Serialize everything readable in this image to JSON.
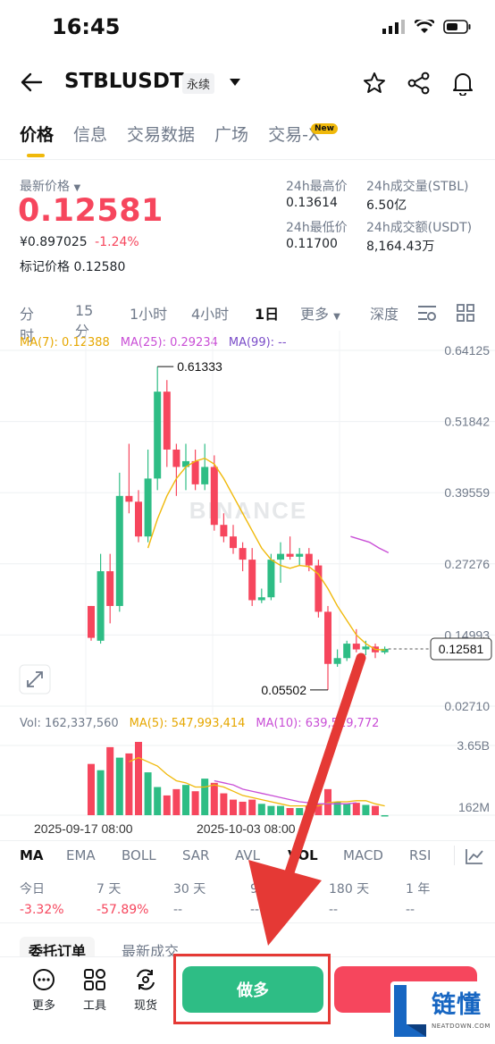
{
  "status": {
    "time": "16:45"
  },
  "header": {
    "pair": "STBLUSDT",
    "contract_type": "永续"
  },
  "tabs": [
    {
      "label": "价格"
    },
    {
      "label": "信息"
    },
    {
      "label": "交易数据"
    },
    {
      "label": "广场"
    },
    {
      "label": "交易-X"
    }
  ],
  "new_badge": "New",
  "price_panel": {
    "last_price_label": "最新价格",
    "last_price": "0.12581",
    "cny_price": "¥0.897025",
    "change_pct": "-1.24%",
    "mark_price_label": "标记价格",
    "mark_price": "0.12580",
    "high_label": "24h最高价",
    "high": "0.13614",
    "vol_label": "24h成交量(STBL)",
    "vol": "6.50亿",
    "low_label": "24h最低价",
    "low": "0.11700",
    "amount_label": "24h成交额(USDT)",
    "amount": "8,164.43万"
  },
  "intervals": [
    "分时",
    "15分",
    "1小时",
    "4小时",
    "1日",
    "更多",
    "深度"
  ],
  "active_interval": "1日",
  "ma_legend": {
    "ma7": "MA(7): 0.12388",
    "ma25": "MA(25): 0.29234",
    "ma99": "MA(99): --"
  },
  "price_axis": [
    "0.64125",
    "0.51842",
    "0.39559",
    "0.27276",
    "0.14993",
    "0.02710"
  ],
  "current_price_tag": "0.12581",
  "high_marker": "0.61333",
  "low_marker": "0.05502",
  "watermark": "BINANCE",
  "vol_legend": {
    "vol": "Vol: 162,337,560",
    "ma5": "MA(5): 547,993,414",
    "ma10": "MA(10): 639,519,772"
  },
  "vol_axis": [
    "3.65B",
    "162M"
  ],
  "date_labels": [
    "2025-09-17 08:00",
    "2025-10-03 08:00"
  ],
  "indicators": [
    "MA",
    "EMA",
    "BOLL",
    "SAR",
    "AVL",
    "VOL",
    "MACD",
    "RSI"
  ],
  "performance": [
    {
      "label": "今日",
      "value": "-3.32%"
    },
    {
      "label": "7 天",
      "value": "-57.89%"
    },
    {
      "label": "30 天",
      "value": "--"
    },
    {
      "label": "90 天",
      "value": "--"
    },
    {
      "label": "180 天",
      "value": "--"
    },
    {
      "label": "1 年",
      "value": "--"
    }
  ],
  "order_tabs": [
    "委托订单",
    "最新成交"
  ],
  "bottom_tools": [
    {
      "label": "更多"
    },
    {
      "label": "工具"
    },
    {
      "label": "现货"
    }
  ],
  "long_button": "做多",
  "logo_text": "链懂",
  "logo_sub": "NEATDOWN.COM",
  "colors": {
    "up": "#2ebd85",
    "down": "#f6465d",
    "accent": "#f0b90b",
    "ma7": "#f0b90b",
    "ma25": "#c94fd6",
    "annotation": "#e53935"
  },
  "chart_data": {
    "type": "candlestick",
    "ylim": [
      0.0271,
      0.64125
    ],
    "candles": [
      {
        "o": 0.2,
        "h": 0.2,
        "l": 0.14,
        "c": 0.145
      },
      {
        "o": 0.14,
        "h": 0.29,
        "l": 0.135,
        "c": 0.26
      },
      {
        "o": 0.26,
        "h": 0.29,
        "l": 0.17,
        "c": 0.2
      },
      {
        "o": 0.2,
        "h": 0.43,
        "l": 0.19,
        "c": 0.39
      },
      {
        "o": 0.39,
        "h": 0.48,
        "l": 0.36,
        "c": 0.38
      },
      {
        "o": 0.38,
        "h": 0.4,
        "l": 0.31,
        "c": 0.32
      },
      {
        "o": 0.32,
        "h": 0.47,
        "l": 0.31,
        "c": 0.42
      },
      {
        "o": 0.42,
        "h": 0.613,
        "l": 0.4,
        "c": 0.57
      },
      {
        "o": 0.57,
        "h": 0.59,
        "l": 0.44,
        "c": 0.47
      },
      {
        "o": 0.47,
        "h": 0.48,
        "l": 0.39,
        "c": 0.44
      },
      {
        "o": 0.44,
        "h": 0.48,
        "l": 0.4,
        "c": 0.45
      },
      {
        "o": 0.45,
        "h": 0.47,
        "l": 0.4,
        "c": 0.41
      },
      {
        "o": 0.41,
        "h": 0.48,
        "l": 0.4,
        "c": 0.44
      },
      {
        "o": 0.44,
        "h": 0.46,
        "l": 0.33,
        "c": 0.34
      },
      {
        "o": 0.34,
        "h": 0.36,
        "l": 0.31,
        "c": 0.32
      },
      {
        "o": 0.32,
        "h": 0.34,
        "l": 0.29,
        "c": 0.3
      },
      {
        "o": 0.3,
        "h": 0.31,
        "l": 0.26,
        "c": 0.28
      },
      {
        "o": 0.28,
        "h": 0.3,
        "l": 0.2,
        "c": 0.21
      },
      {
        "o": 0.21,
        "h": 0.23,
        "l": 0.205,
        "c": 0.215
      },
      {
        "o": 0.215,
        "h": 0.29,
        "l": 0.21,
        "c": 0.28
      },
      {
        "o": 0.28,
        "h": 0.31,
        "l": 0.24,
        "c": 0.29
      },
      {
        "o": 0.29,
        "h": 0.32,
        "l": 0.28,
        "c": 0.285
      },
      {
        "o": 0.285,
        "h": 0.3,
        "l": 0.27,
        "c": 0.29
      },
      {
        "o": 0.29,
        "h": 0.3,
        "l": 0.26,
        "c": 0.27
      },
      {
        "o": 0.27,
        "h": 0.28,
        "l": 0.18,
        "c": 0.19
      },
      {
        "o": 0.19,
        "h": 0.2,
        "l": 0.055,
        "c": 0.1
      },
      {
        "o": 0.1,
        "h": 0.125,
        "l": 0.095,
        "c": 0.11
      },
      {
        "o": 0.11,
        "h": 0.14,
        "l": 0.105,
        "c": 0.135
      },
      {
        "o": 0.135,
        "h": 0.16,
        "l": 0.12,
        "c": 0.125
      },
      {
        "o": 0.125,
        "h": 0.14,
        "l": 0.115,
        "c": 0.13
      },
      {
        "o": 0.13,
        "h": 0.135,
        "l": 0.11,
        "c": 0.12
      },
      {
        "o": 0.12,
        "h": 0.13,
        "l": 0.117,
        "c": 0.126
      }
    ],
    "ma7": [
      null,
      null,
      null,
      null,
      null,
      null,
      0.3,
      0.35,
      0.39,
      0.42,
      0.44,
      0.45,
      0.455,
      0.445,
      0.42,
      0.39,
      0.36,
      0.33,
      0.3,
      0.28,
      0.27,
      0.265,
      0.27,
      0.268,
      0.255,
      0.23,
      0.2,
      0.175,
      0.15,
      0.135,
      0.125,
      0.124
    ],
    "ma25": [
      null,
      null,
      null,
      null,
      null,
      null,
      null,
      null,
      null,
      null,
      null,
      null,
      null,
      null,
      null,
      null,
      null,
      null,
      null,
      null,
      null,
      null,
      null,
      null,
      0.32,
      0.315,
      0.31,
      0.3,
      0.292
    ],
    "volumes": [
      2.6,
      2.3,
      3.4,
      2.9,
      3.1,
      3.65,
      2.2,
      1.5,
      1.1,
      1.4,
      1.6,
      1.3,
      1.9,
      1.7,
      1.2,
      0.9,
      0.8,
      0.9,
      0.7,
      0.6,
      0.6,
      0.5,
      0.5,
      0.6,
      0.7,
      1.4,
      0.8,
      0.7,
      0.75,
      0.65,
      0.6,
      0.16
    ],
    "vol_ma5": [
      null,
      null,
      null,
      null,
      2.7,
      2.9,
      2.7,
      2.5,
      2.1,
      1.8,
      1.7,
      1.5,
      1.5,
      1.6,
      1.5,
      1.3,
      1.1,
      1.0,
      0.9,
      0.8,
      0.7,
      0.6,
      0.6,
      0.6,
      0.6,
      0.75,
      0.8,
      0.8,
      0.85,
      0.85,
      0.7,
      0.6
    ],
    "vol_ma10": [
      null,
      null,
      null,
      null,
      null,
      null,
      null,
      null,
      null,
      null,
      null,
      null,
      null,
      1.8,
      1.7,
      1.6,
      1.4,
      1.3,
      1.2,
      1.1,
      1.0,
      0.9,
      0.8,
      0.75,
      0.7,
      0.7,
      0.7,
      0.7,
      0.75
    ],
    "vol_ylim": [
      0.16,
      3.65
    ]
  }
}
